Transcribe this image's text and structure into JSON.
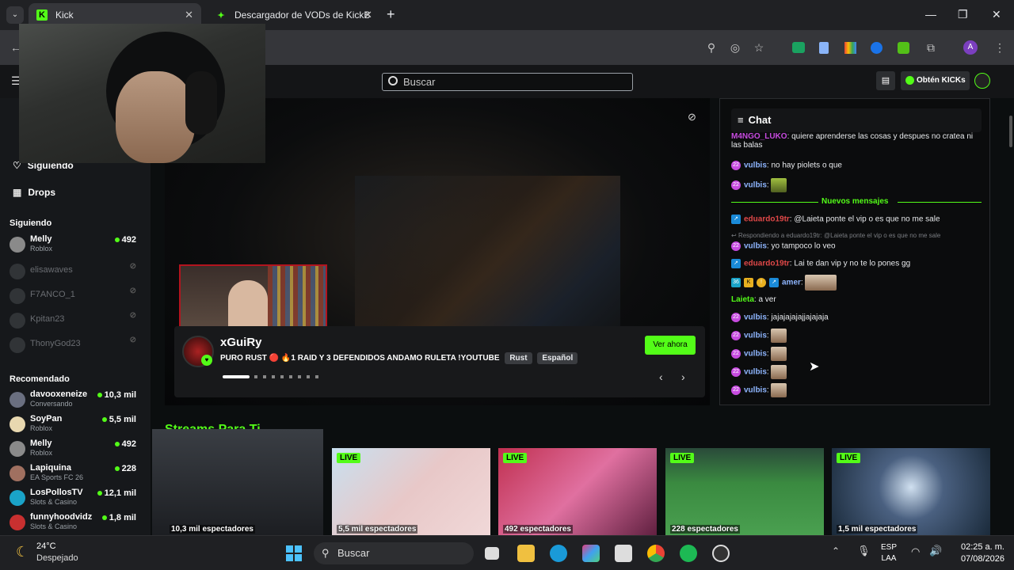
{
  "browser": {
    "tabs": [
      {
        "title": "Kick",
        "active": true
      },
      {
        "title": "Descargador de VODs de KickB",
        "active": false
      }
    ],
    "new_tab": "+",
    "window_controls": {
      "min": "—",
      "max": "❐",
      "close": "✕"
    }
  },
  "site": {
    "search_placeholder": "Buscar",
    "get_kicks": "Obtén KICKs",
    "nav": {
      "following": "Siguiendo",
      "drops": "Drops"
    },
    "following_header": "Siguiendo",
    "following": [
      {
        "name": "Melly",
        "category": "Roblox",
        "viewers": "492",
        "live": true
      },
      {
        "name": "elisawaves",
        "live": false
      },
      {
        "name": "F7ANCO_1",
        "live": false
      },
      {
        "name": "Kpitan23",
        "live": false
      },
      {
        "name": "ThonyGod23",
        "live": false
      }
    ],
    "recommended_header": "Recomendado",
    "recommended": [
      {
        "name": "davooxeneize",
        "category": "Conversando",
        "viewers": "10,3 mil"
      },
      {
        "name": "SoyPan",
        "category": "Roblox",
        "viewers": "5,5 mil"
      },
      {
        "name": "Melly",
        "category": "Roblox",
        "viewers": "492"
      },
      {
        "name": "Lapiquina",
        "category": "EA Sports FC 26",
        "viewers": "228"
      },
      {
        "name": "LosPollosTV",
        "category": "Slots & Casino",
        "viewers": "12,1 mil"
      },
      {
        "name": "funnyhoodvidz",
        "category": "Slots & Casino",
        "viewers": "1,8 mil"
      }
    ],
    "featured": {
      "streamer": "xGuiRy",
      "title": "PURO RUST 🔴 🔥1 RAID Y 3 DEFENDIDOS ANDAMO RULETA !YOUTUBE",
      "tags": [
        "Rust",
        "Español"
      ],
      "watch_button": "Ver ahora"
    },
    "section_title": "Streams Para Ti",
    "cards": [
      {
        "viewers": "10,3 mil espectadores",
        "live": false
      },
      {
        "viewers": "5,5 mil espectadores",
        "live": true
      },
      {
        "viewers": "492 espectadores",
        "live": true
      },
      {
        "viewers": "228 espectadores",
        "live": true
      },
      {
        "viewers": "1,5 mil espectadores",
        "live": true
      }
    ],
    "live_label": "LIVE",
    "chat": {
      "title": "Chat",
      "new_messages": "Nuevos mensajes",
      "messages": [
        {
          "user": "M4NGO_LUKO",
          "text": ": quiere aprenderse las cosas y despues no cratea ni las balas"
        },
        {
          "user": "vulbis",
          "text": ": no hay piolets o que"
        },
        {
          "user": "vulbis",
          "text": ":"
        },
        {
          "user": "eduardo19tr",
          "text": ": @Laieta ponte el vip o es que no me sale"
        },
        {
          "reply": "Respondiendo a eduardo19tr: @Laieta ponte el vip o es que no me sale"
        },
        {
          "user": "vulbis",
          "text": ": yo tampoco lo veo"
        },
        {
          "user": "eduardo19tr",
          "text": ": Lai te dan vip y no te lo pones gg"
        },
        {
          "user": "amer",
          "text": ":"
        },
        {
          "user": "Laieta",
          "text": ": a ver"
        },
        {
          "user": "vulbis",
          "text": ": jajajajajajjajajaja"
        },
        {
          "user": "vulbis",
          "text": ":"
        },
        {
          "user": "vulbis",
          "text": ":"
        },
        {
          "user": "vulbis",
          "text": ":"
        },
        {
          "user": "vulbis",
          "text": ":"
        }
      ]
    }
  },
  "taskbar": {
    "weather_temp": "24°C",
    "weather_desc": "Despejado",
    "search": "Buscar",
    "lang": "ESP",
    "layout": "LAA",
    "time": "02:25 a. m.",
    "date": "07/08/2026"
  },
  "colors": {
    "kick_green": "#53fc18",
    "bg": "#0b0e0f"
  }
}
